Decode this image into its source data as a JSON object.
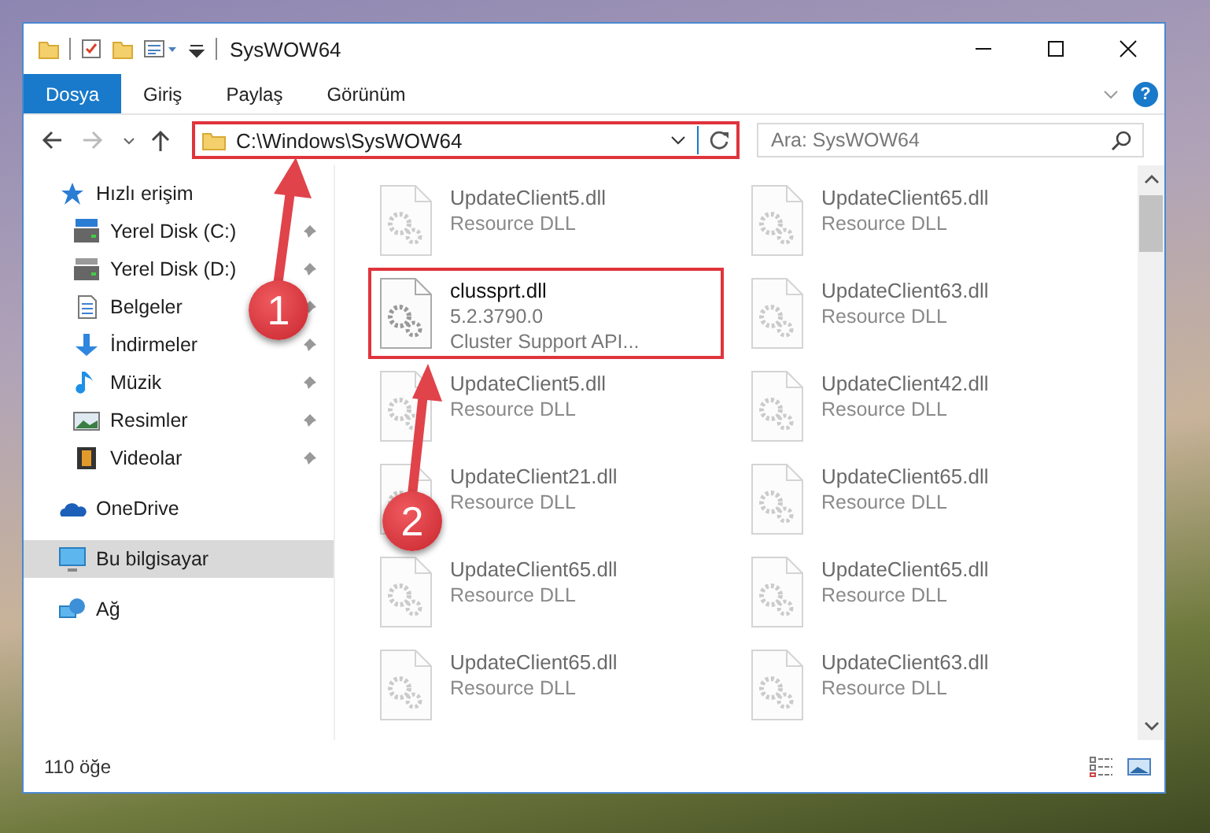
{
  "window": {
    "title": "SysWOW64"
  },
  "ribbon": {
    "tabs": [
      {
        "label": "Dosya",
        "selected": true
      },
      {
        "label": "Giriş",
        "selected": false
      },
      {
        "label": "Paylaş",
        "selected": false
      },
      {
        "label": "Görünüm",
        "selected": false
      }
    ],
    "help": "?"
  },
  "address": {
    "path": "C:\\Windows\\SysWOW64",
    "highlighted": true
  },
  "search": {
    "placeholder": "Ara: SysWOW64"
  },
  "nav": {
    "items": [
      {
        "label": "Hızlı erişim",
        "kind": "star",
        "selected": false,
        "children": [
          {
            "label": "Yerel Disk (C:)",
            "kind": "system-drive",
            "selected": false,
            "pinned": true
          },
          {
            "label": "Yerel Disk (D:)",
            "kind": "drive",
            "selected": false,
            "pinned": true
          },
          {
            "label": "Belgeler",
            "kind": "documents",
            "selected": false,
            "pinned": true
          },
          {
            "label": "İndirmeler",
            "kind": "downloads",
            "selected": false,
            "pinned": true
          },
          {
            "label": "Müzik",
            "kind": "music",
            "selected": false,
            "pinned": true
          },
          {
            "label": "Resimler",
            "kind": "pictures",
            "selected": false,
            "pinned": true
          },
          {
            "label": "Videolar",
            "kind": "videos",
            "selected": false,
            "pinned": true
          }
        ]
      },
      {
        "label": "OneDrive",
        "kind": "cloud",
        "selected": false
      },
      {
        "label": "Bu bilgisayar",
        "kind": "computer",
        "selected": true
      },
      {
        "label": "Ağ",
        "kind": "network",
        "selected": false
      }
    ]
  },
  "files": [
    {
      "name": "UpdateClient5.dll",
      "lines": [
        "Resource DLL"
      ],
      "blurred": true,
      "highlighted": false
    },
    {
      "name": "UpdateClient65.dll",
      "lines": [
        "Resource DLL"
      ],
      "blurred": true,
      "highlighted": false
    },
    {
      "name": "clussprt.dll",
      "lines": [
        "5.2.3790.0",
        "Cluster Support API..."
      ],
      "blurred": false,
      "highlighted": true
    },
    {
      "name": "UpdateClient63.dll",
      "lines": [
        "Resource DLL"
      ],
      "blurred": true,
      "highlighted": false
    },
    {
      "name": "UpdateClient5.dll",
      "lines": [
        "Resource DLL"
      ],
      "blurred": true,
      "highlighted": false
    },
    {
      "name": "UpdateClient42.dll",
      "lines": [
        "Resource DLL"
      ],
      "blurred": true,
      "highlighted": false
    },
    {
      "name": "UpdateClient21.dll",
      "lines": [
        "Resource DLL"
      ],
      "blurred": true,
      "highlighted": false
    },
    {
      "name": "UpdateClient65.dll",
      "lines": [
        "Resource DLL"
      ],
      "blurred": true,
      "highlighted": false
    },
    {
      "name": "UpdateClient65.dll",
      "lines": [
        "Resource DLL"
      ],
      "blurred": true,
      "highlighted": false
    },
    {
      "name": "UpdateClient65.dll",
      "lines": [
        "Resource DLL"
      ],
      "blurred": true,
      "highlighted": false
    },
    {
      "name": "UpdateClient65.dll",
      "lines": [
        "Resource DLL"
      ],
      "blurred": true,
      "highlighted": false
    },
    {
      "name": "UpdateClient63.dll",
      "lines": [
        "Resource DLL"
      ],
      "blurred": true,
      "highlighted": false
    }
  ],
  "status_bar": {
    "count": "110 öğe"
  },
  "annotations": [
    {
      "number": "1"
    },
    {
      "number": "2"
    }
  ]
}
